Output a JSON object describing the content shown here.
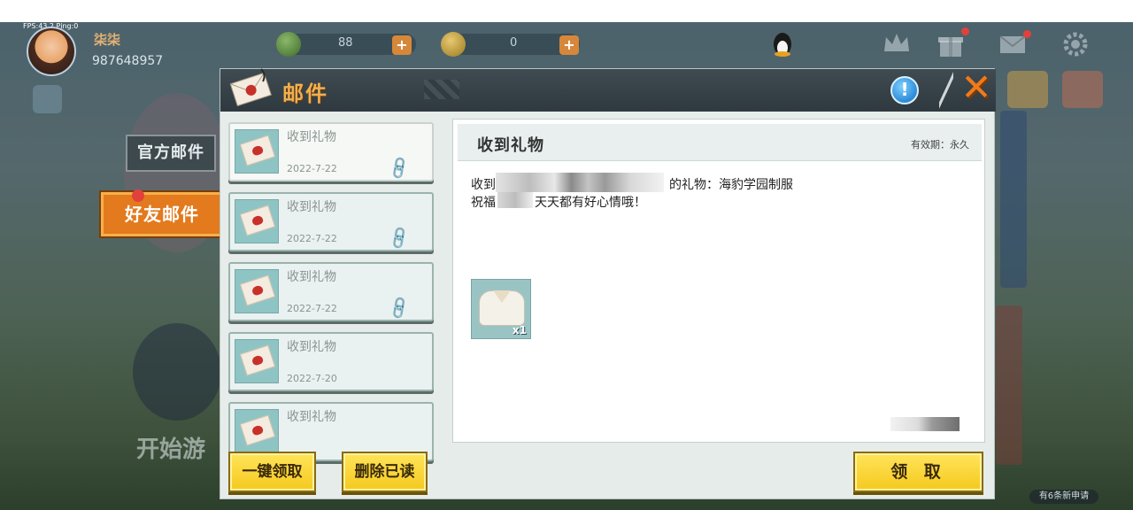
{
  "hud": {
    "fps": "FPS:43.2  Ping:0",
    "player_name": "柒柒",
    "player_id": "987648957",
    "gems": "88",
    "coins": "0",
    "plus": "+"
  },
  "mail": {
    "title": "邮件",
    "info_icon": "!",
    "close_icon": "✕",
    "tabs": [
      {
        "label": "官方邮件",
        "active": false
      },
      {
        "label": "好友邮件",
        "active": true
      }
    ],
    "items": [
      {
        "subject": "收到礼物",
        "date": "2022-7-22",
        "has_attachment": true
      },
      {
        "subject": "收到礼物",
        "date": "2022-7-22",
        "has_attachment": true
      },
      {
        "subject": "收到礼物",
        "date": "2022-7-22",
        "has_attachment": true
      },
      {
        "subject": "收到礼物",
        "date": "2022-7-20",
        "has_attachment": false
      },
      {
        "subject": "收到礼物",
        "date": "",
        "has_attachment": false
      }
    ],
    "buttons": {
      "claim_all": "一键领取",
      "delete_read": "删除已读",
      "claim": "领 取"
    },
    "detail": {
      "title": "收到礼物",
      "validity": "有效期：永久",
      "line1_prefix": "收到",
      "line1_suffix": "的礼物：海豹学园制服",
      "line2_prefix": "祝福",
      "line2_suffix": "天天都有好心情哦！",
      "attachment_qty": "x1"
    }
  },
  "background": {
    "start_game": "开始游",
    "apply_badge": "有6条新申请"
  },
  "colors": {
    "accent_orange": "#e37a1e",
    "title_gold": "#f0b050",
    "button_yellow": "#f5c91e",
    "header_dark": "#2f393f"
  }
}
